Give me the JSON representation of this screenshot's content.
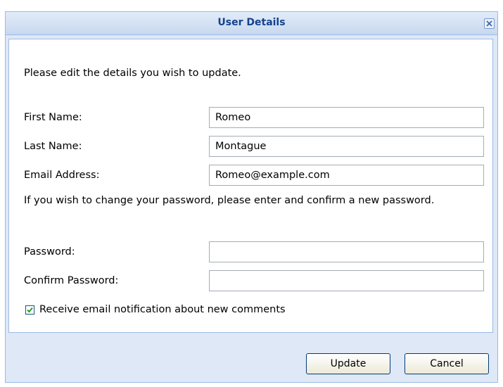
{
  "dialog": {
    "title": "User Details",
    "close_icon": "close-icon"
  },
  "form": {
    "intro": "Please edit the details you wish to update.",
    "first_name_label": "First Name:",
    "first_name_value": "Romeo",
    "last_name_label": "Last Name:",
    "last_name_value": "Montague",
    "email_label": "Email Address:",
    "email_value": "Romeo@example.com",
    "password_note": "If you wish to change your password, please enter and confirm a new password.",
    "password_label": "Password:",
    "password_value": "",
    "confirm_password_label": "Confirm Password:",
    "confirm_password_value": "",
    "notify_label": "Receive email notification about new comments",
    "notify_checked": true
  },
  "buttons": {
    "update": "Update",
    "cancel": "Cancel"
  },
  "colors": {
    "title_text": "#15428b",
    "dialog_background": "#dfe8f6",
    "dialog_border": "#99bbe8"
  }
}
